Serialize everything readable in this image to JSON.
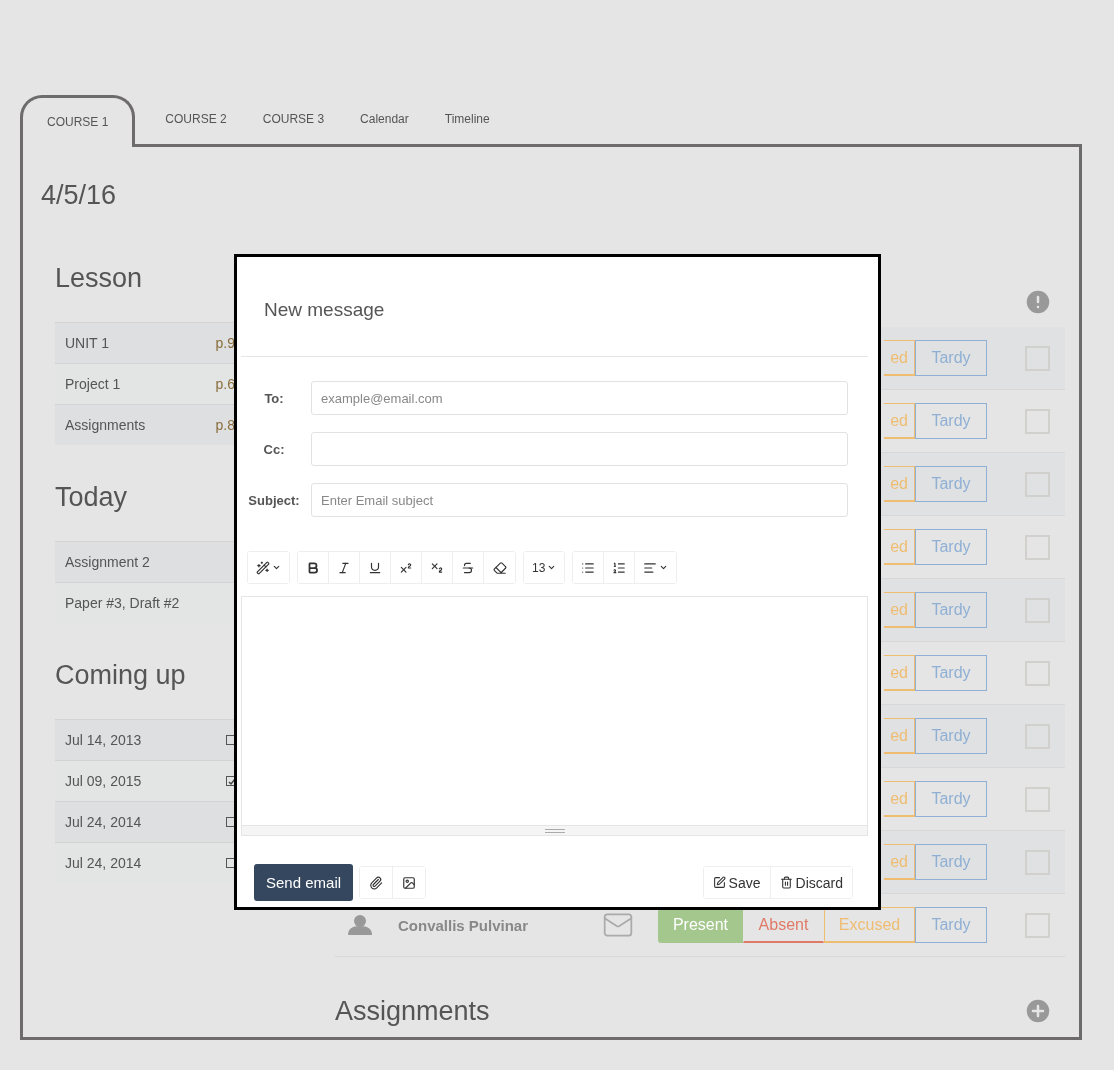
{
  "tabs": [
    {
      "label": "COURSE 1",
      "selected": true
    },
    {
      "label": "COURSE 2",
      "selected": false
    },
    {
      "label": "COURSE 3",
      "selected": false
    },
    {
      "label": "Calendar",
      "selected": false
    },
    {
      "label": "Timeline",
      "selected": false
    }
  ],
  "date": "4/5/16",
  "lesson": {
    "title": "Lesson",
    "rows": [
      {
        "label": "UNIT 1",
        "page": "p.9"
      },
      {
        "label": "Project 1",
        "page": "p.6"
      },
      {
        "label": "Assignments",
        "page": "p.8"
      }
    ]
  },
  "today": {
    "title": "Today",
    "rows": [
      {
        "label": "Assignment 2"
      },
      {
        "label": "Paper #3, Draft #2"
      }
    ]
  },
  "coming_up": {
    "title": "Coming up",
    "rows": [
      {
        "date": "Jul 14, 2013",
        "checked": false
      },
      {
        "date": "Jul 09, 2015",
        "checked": true
      },
      {
        "date": "Jul 24, 2014",
        "checked": false
      },
      {
        "date": "Jul 24, 2014",
        "checked": false
      }
    ]
  },
  "attendance": {
    "rows": [
      {
        "buttons": [
          {
            "kind": "excused",
            "label": "ed",
            "selected": false
          },
          {
            "kind": "tardy",
            "label": "Tardy",
            "selected": false
          }
        ],
        "checked": false
      },
      {
        "buttons": [
          {
            "kind": "excused",
            "label": "ed",
            "selected": false
          },
          {
            "kind": "tardy",
            "label": "Tardy",
            "selected": false
          }
        ],
        "checked": false
      },
      {
        "buttons": [
          {
            "kind": "excused",
            "label": "ed",
            "selected": false
          },
          {
            "kind": "tardy",
            "label": "Tardy",
            "selected": false
          }
        ],
        "checked": false
      },
      {
        "buttons": [
          {
            "kind": "excused",
            "label": "ed",
            "selected": false
          },
          {
            "kind": "tardy",
            "label": "Tardy",
            "selected": false
          }
        ],
        "checked": false
      },
      {
        "buttons": [
          {
            "kind": "excused",
            "label": "ed",
            "selected": false
          },
          {
            "kind": "tardy",
            "label": "Tardy",
            "selected": false
          }
        ],
        "checked": false
      },
      {
        "buttons": [
          {
            "kind": "excused",
            "label": "ed",
            "selected": false
          },
          {
            "kind": "tardy",
            "label": "Tardy",
            "selected": false
          }
        ],
        "checked": false
      },
      {
        "buttons": [
          {
            "kind": "excused",
            "label": "ed",
            "selected": false
          },
          {
            "kind": "tardy",
            "label": "Tardy",
            "selected": false
          }
        ],
        "checked": false
      },
      {
        "buttons": [
          {
            "kind": "excused",
            "label": "ed",
            "selected": false
          },
          {
            "kind": "tardy",
            "label": "Tardy",
            "selected": false
          }
        ],
        "checked": false
      },
      {
        "buttons": [
          {
            "kind": "excused",
            "label": "ed",
            "selected": false
          },
          {
            "kind": "tardy",
            "label": "Tardy",
            "selected": false
          }
        ],
        "checked": false
      },
      {
        "name": "Convallis Pulvinar",
        "buttons": [
          {
            "kind": "present",
            "label": "Present",
            "selected": true
          },
          {
            "kind": "absent",
            "label": "Absent",
            "selected": false
          },
          {
            "kind": "excused",
            "label": "Excused",
            "selected": false
          },
          {
            "kind": "tardy",
            "label": "Tardy",
            "selected": false
          }
        ],
        "checked": false
      }
    ]
  },
  "assignments": {
    "title": "Assignments"
  },
  "modal": {
    "title": "New message",
    "fields": [
      {
        "label": "To:",
        "placeholder": "example@email.com"
      },
      {
        "label": "Cc:"
      },
      {
        "label": "Subject:",
        "placeholder": "Enter Email subject"
      }
    ],
    "toolbar": [
      [
        {
          "kind": "wand",
          "dropdown": true
        }
      ],
      [
        {
          "kind": "bold"
        },
        {
          "kind": "italic"
        },
        {
          "kind": "underline"
        },
        {
          "kind": "superscript"
        },
        {
          "kind": "subscript"
        },
        {
          "kind": "strike"
        },
        {
          "kind": "eraser"
        }
      ],
      [
        {
          "kind": "size",
          "label": "13",
          "dropdown": true
        }
      ],
      [
        {
          "kind": "bullets"
        },
        {
          "kind": "numbers"
        },
        {
          "kind": "align",
          "dropdown": true
        }
      ]
    ],
    "send": "Send email",
    "save": "Save",
    "discard": "Discard"
  }
}
